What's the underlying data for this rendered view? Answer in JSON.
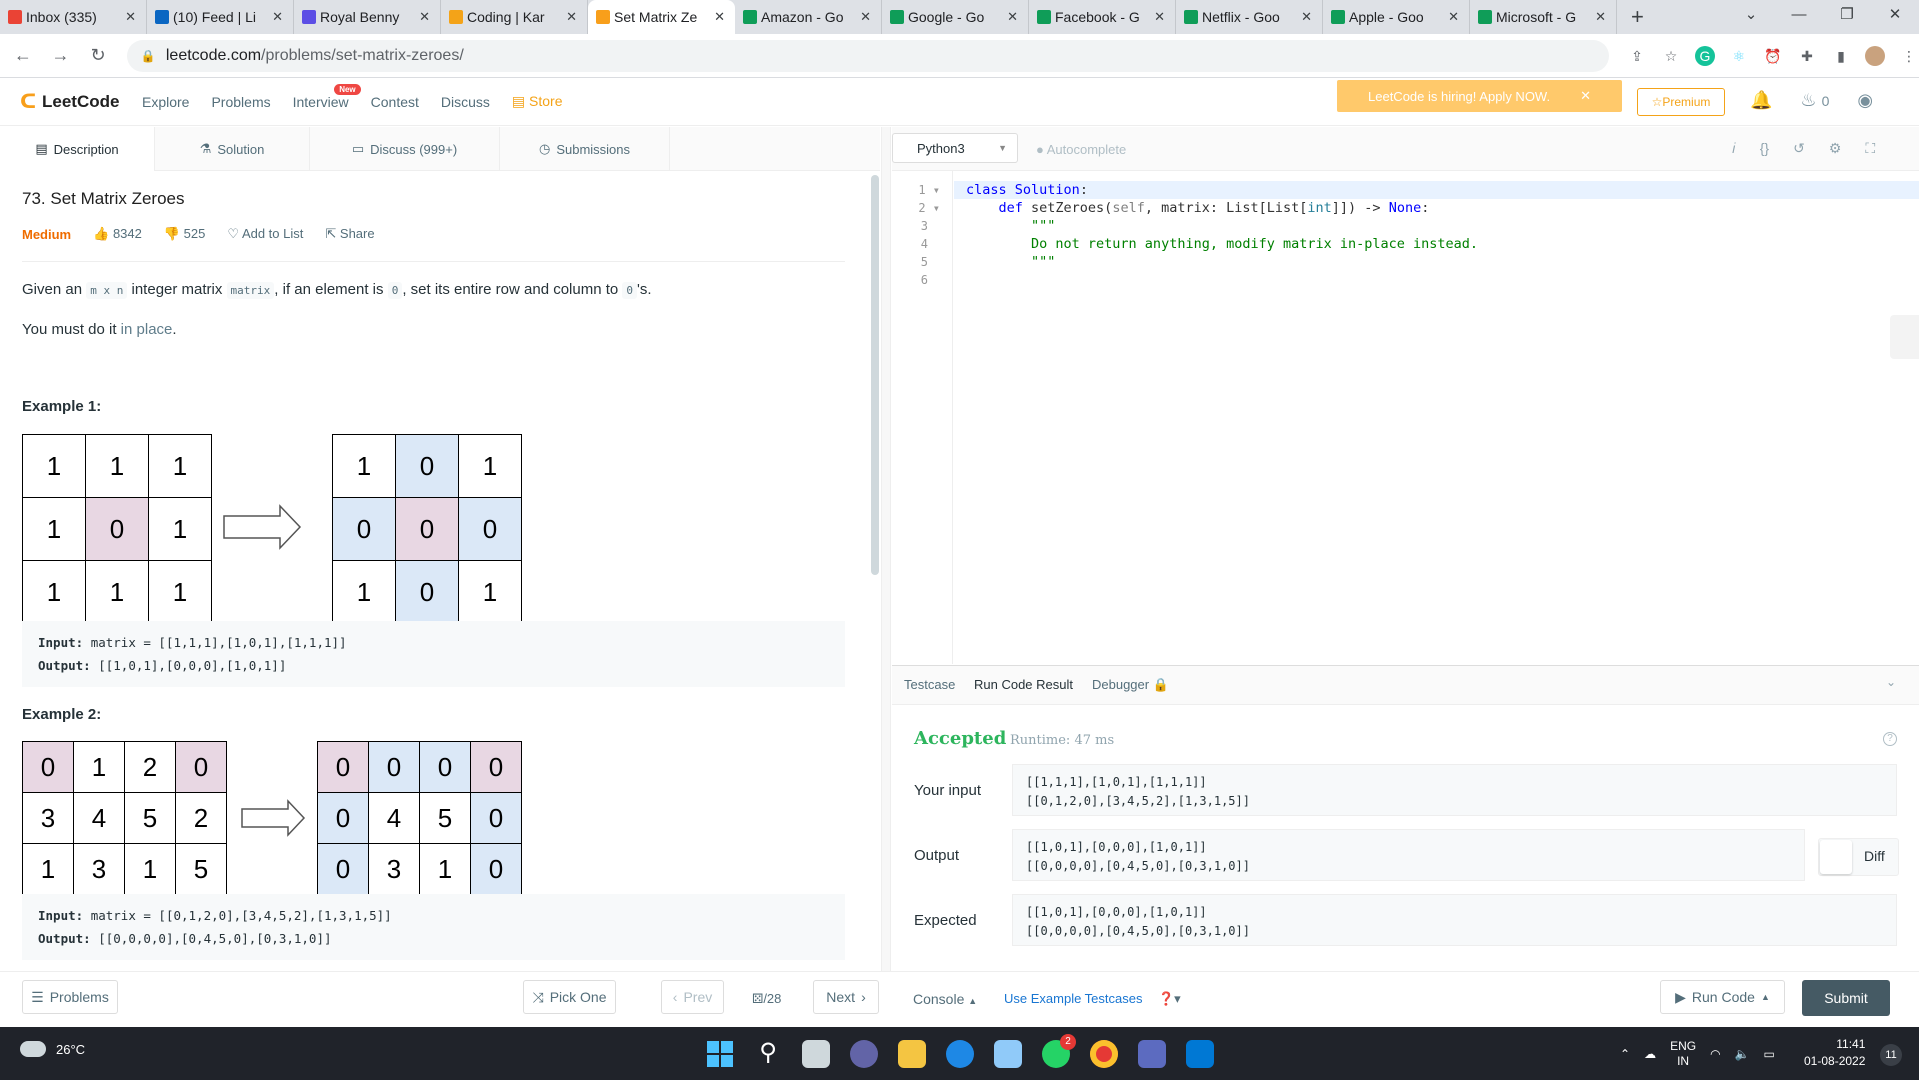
{
  "browser": {
    "tabs": [
      {
        "label": "Inbox (335)",
        "color": "#ea4335"
      },
      {
        "label": "(10) Feed | Li",
        "color": "#0a66c2"
      },
      {
        "label": "Royal Benny",
        "color": "#5c4ee5"
      },
      {
        "label": "Coding | Kar",
        "color": "#f4a318"
      },
      {
        "label": "Set Matrix Ze",
        "color": "#f89f1b"
      },
      {
        "label": "Amazon - Go",
        "color": "#0f9d58"
      },
      {
        "label": "Google - Go",
        "color": "#0f9d58"
      },
      {
        "label": "Facebook - G",
        "color": "#0f9d58"
      },
      {
        "label": "Netflix - Goo",
        "color": "#0f9d58"
      },
      {
        "label": "Apple - Goo",
        "color": "#0f9d58"
      },
      {
        "label": "Microsoft - G",
        "color": "#0f9d58"
      }
    ],
    "url_host": "leetcode.com",
    "url_path": "/problems/set-matrix-zeroes/"
  },
  "header": {
    "logo": "LeetCode",
    "nav": [
      "Explore",
      "Problems",
      "Interview",
      "Contest",
      "Discuss",
      "Store"
    ],
    "new_badge": "New",
    "hiring": "LeetCode is hiring! Apply NOW.",
    "premium": "Premium",
    "streak": "0"
  },
  "left_tabs": [
    "Description",
    "Solution",
    "Discuss (999+)",
    "Submissions"
  ],
  "problem": {
    "title": "73. Set Matrix Zeroes",
    "difficulty": "Medium",
    "likes": "8342",
    "dislikes": "525",
    "add_to_list": "Add to List",
    "share": "Share",
    "desc_pre": "Given an ",
    "desc_code1": "m x n",
    "desc_mid1": " integer matrix ",
    "desc_code2": "matrix",
    "desc_mid2": ", if an element is ",
    "desc_code3": "0",
    "desc_mid3": ", set its entire row and column to ",
    "desc_code4": "0",
    "desc_post": "'s.",
    "inplace_pre": "You must do it ",
    "inplace_link": "in place",
    "inplace_post": ".",
    "example1": {
      "heading": "Example 1:",
      "input_label": "Input:",
      "input": "matrix = [[1,1,1],[1,0,1],[1,1,1]]",
      "output_label": "Output:",
      "output": "[[1,0,1],[0,0,0],[1,0,1]]",
      "before": [
        [
          "1",
          "1",
          "1"
        ],
        [
          "1",
          "0",
          "1"
        ],
        [
          "1",
          "1",
          "1"
        ]
      ],
      "after": [
        [
          "1",
          "0",
          "1"
        ],
        [
          "0",
          "0",
          "0"
        ],
        [
          "1",
          "0",
          "1"
        ]
      ]
    },
    "example2": {
      "heading": "Example 2:",
      "input_label": "Input:",
      "input": "matrix = [[0,1,2,0],[3,4,5,2],[1,3,1,5]]",
      "output_label": "Output:",
      "output": "[[0,0,0,0],[0,4,5,0],[0,3,1,0]]",
      "before": [
        [
          "0",
          "1",
          "2",
          "0"
        ],
        [
          "3",
          "4",
          "5",
          "2"
        ],
        [
          "1",
          "3",
          "1",
          "5"
        ]
      ],
      "after": [
        [
          "0",
          "0",
          "0",
          "0"
        ],
        [
          "0",
          "4",
          "5",
          "0"
        ],
        [
          "0",
          "3",
          "1",
          "0"
        ]
      ]
    }
  },
  "editor": {
    "language": "Python3",
    "autocomplete": "Autocomplete",
    "line_numbers": [
      "1",
      "2",
      "3",
      "4",
      "5",
      "6"
    ]
  },
  "result": {
    "tabs": [
      "Testcase",
      "Run Code Result",
      "Debugger"
    ],
    "status": "Accepted",
    "runtime": "Runtime: 47 ms",
    "your_input_label": "Your input",
    "your_input": [
      "[[1,1,1],[1,0,1],[1,1,1]]",
      "[[0,1,2,0],[3,4,5,2],[1,3,1,5]]"
    ],
    "output_label": "Output",
    "output": [
      "[[1,0,1],[0,0,0],[1,0,1]]",
      "[[0,0,0,0],[0,4,5,0],[0,3,1,0]]"
    ],
    "expected_label": "Expected",
    "expected": [
      "[[1,0,1],[0,0,0],[1,0,1]]",
      "[[0,0,0,0],[0,4,5,0],[0,3,1,0]]"
    ],
    "diff": "Diff"
  },
  "bottom": {
    "problems": "Problems",
    "pick_one": "Pick One",
    "prev": "Prev",
    "page": "/28",
    "next": "Next",
    "console": "Console",
    "use_example": "Use Example Testcases",
    "run_code": "Run Code",
    "submit": "Submit"
  },
  "taskbar": {
    "weather": "26°C",
    "lang1": "ENG",
    "lang2": "IN",
    "time": "11:41",
    "date": "01-08-2022",
    "notifications": "11",
    "whatsapp_badge": "2"
  }
}
